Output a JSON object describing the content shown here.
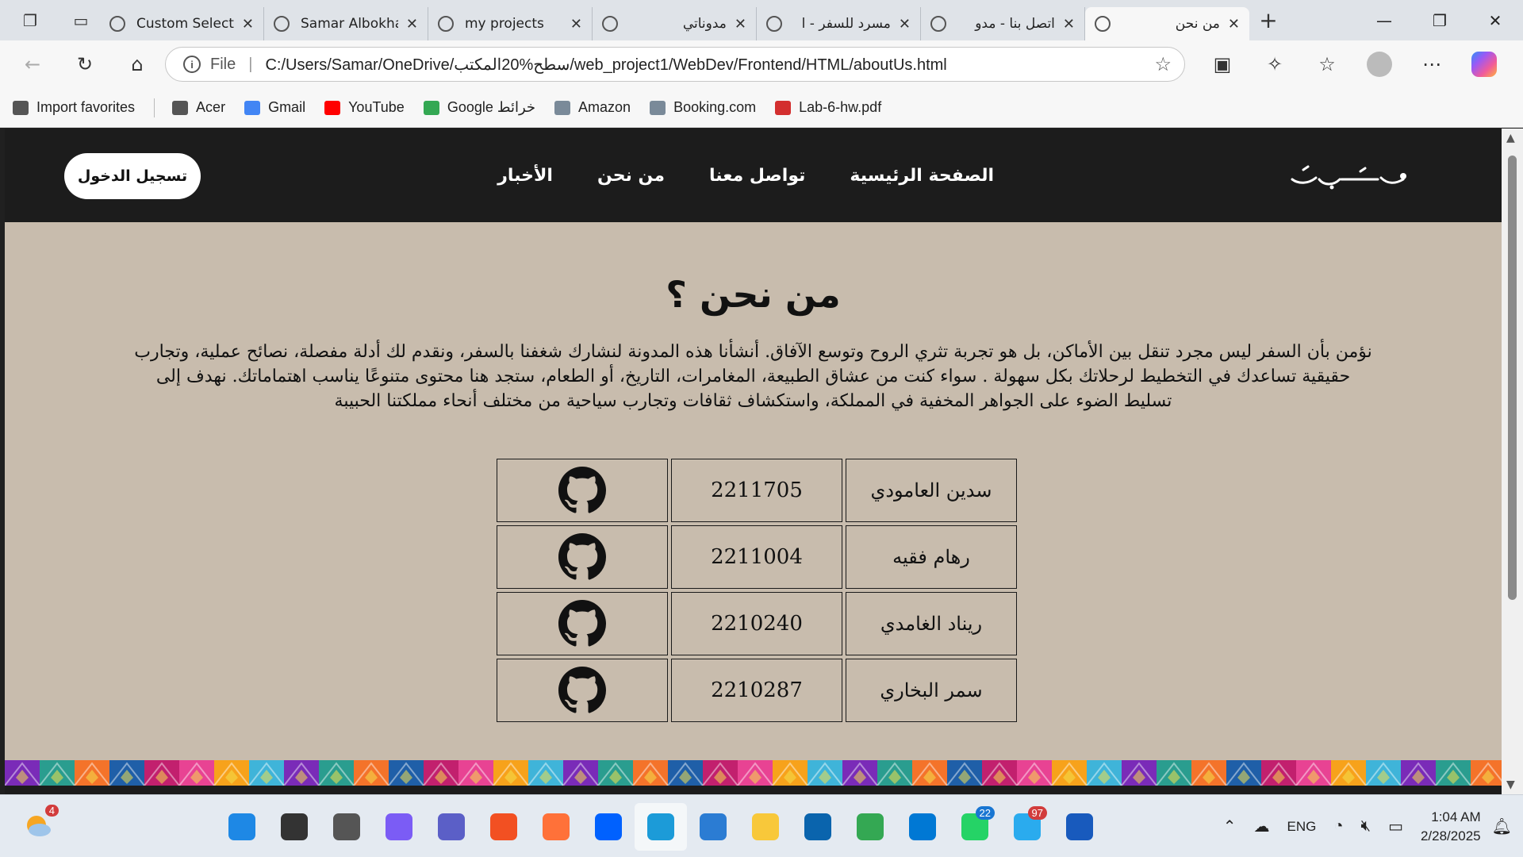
{
  "browser": {
    "tabs": [
      {
        "title": "Custom Select",
        "rtl": false
      },
      {
        "title": "Samar Albokhari",
        "rtl": false
      },
      {
        "title": "my projects",
        "rtl": false
      },
      {
        "title": "مدوناتي",
        "rtl": true
      },
      {
        "title": "مسرد للسفر - ا",
        "rtl": true
      },
      {
        "title": "اتصل بنا - مدو",
        "rtl": true
      },
      {
        "title": "من نحن",
        "rtl": true,
        "active": true
      }
    ],
    "new_tab_symbol": "+",
    "address": {
      "scheme_label": "File",
      "url": "C:/Users/Samar/OneDrive/سطح%20المكتب/web_project1/WebDev/Frontend/HTML/aboutUs.html"
    },
    "favorites": [
      {
        "label": "Import favorites",
        "icon": "import-icon"
      },
      {
        "label": "Acer",
        "icon": "folder-icon"
      },
      {
        "label": "Gmail",
        "icon": "google-icon"
      },
      {
        "label": "YouTube",
        "icon": "youtube-icon"
      },
      {
        "label": "Google خرائط",
        "icon": "maps-icon"
      },
      {
        "label": "Amazon",
        "icon": "amazon-icon"
      },
      {
        "label": "Booking.com",
        "icon": "booking-icon"
      },
      {
        "label": "Lab-6-hw.pdf",
        "icon": "pdf-icon"
      }
    ]
  },
  "site": {
    "login_label": "تسجيل الدخول",
    "nav": [
      "الصفحة الرئيسية",
      "تواصل معنا",
      "من نحن",
      "الأخبار"
    ],
    "title": "من نحن ؟",
    "intro": "نؤمن بأن السفر ليس مجرد تنقل بين الأماكن، بل هو تجربة تثري الروح وتوسع الآفاق. أنشأنا هذه المدونة لنشارك شغفنا بالسفر، ونقدم لك أدلة مفصلة، نصائح عملية، وتجارب حقيقية تساعدك في التخطيط لرحلاتك بكل سهولة . سواء كنت من عشاق الطبيعة، المغامرات، التاريخ، أو الطعام، ستجد هنا محتوى متنوعًا يناسب اهتماماتك. نهدف إلى تسليط الضوء على الجواهر المخفية في المملكة، واستكشاف ثقافات وتجارب سياحية من مختلف أنحاء مملكتنا الحبيبة",
    "team": [
      {
        "name": "سدين العامودي",
        "id": "2211705",
        "link_icon": "github-icon"
      },
      {
        "name": "رهام فقيه",
        "id": "2211004",
        "link_icon": "github-icon"
      },
      {
        "name": "ريناد الغامدي",
        "id": "2210240",
        "link_icon": "github-icon"
      },
      {
        "name": "سمر البخاري",
        "id": "2210287",
        "link_icon": "github-icon"
      }
    ]
  },
  "taskbar": {
    "weather_badge": "4",
    "apps": [
      {
        "name": "start-icon",
        "color": "#1e88e5"
      },
      {
        "name": "search-icon",
        "color": "#333333"
      },
      {
        "name": "task-view-icon",
        "color": "#555555"
      },
      {
        "name": "copilot-icon",
        "color": "#7b5cf5"
      },
      {
        "name": "teams-icon",
        "color": "#5b5fc7"
      },
      {
        "name": "store-icon",
        "color": "#f25022"
      },
      {
        "name": "firefox-icon",
        "color": "#ff7139"
      },
      {
        "name": "dropbox-icon",
        "color": "#0061fe"
      },
      {
        "name": "edge-icon",
        "color": "#1c9bd8",
        "active": true
      },
      {
        "name": "calendar-icon",
        "color": "#2b7cd3"
      },
      {
        "name": "file-explorer-icon",
        "color": "#f8c83a"
      },
      {
        "name": "outlook-icon",
        "color": "#0a64ad"
      },
      {
        "name": "chrome-icon",
        "color": "#34a853"
      },
      {
        "name": "vscode-icon",
        "color": "#0078d4"
      },
      {
        "name": "whatsapp-icon",
        "color": "#25d366",
        "badge": "22"
      },
      {
        "name": "telegram-icon",
        "color": "#2aabee",
        "badge": "97"
      },
      {
        "name": "word-icon",
        "color": "#185abd"
      }
    ],
    "tray": {
      "language": "ENG",
      "time": "1:04 AM",
      "date": "2/28/2025"
    }
  }
}
